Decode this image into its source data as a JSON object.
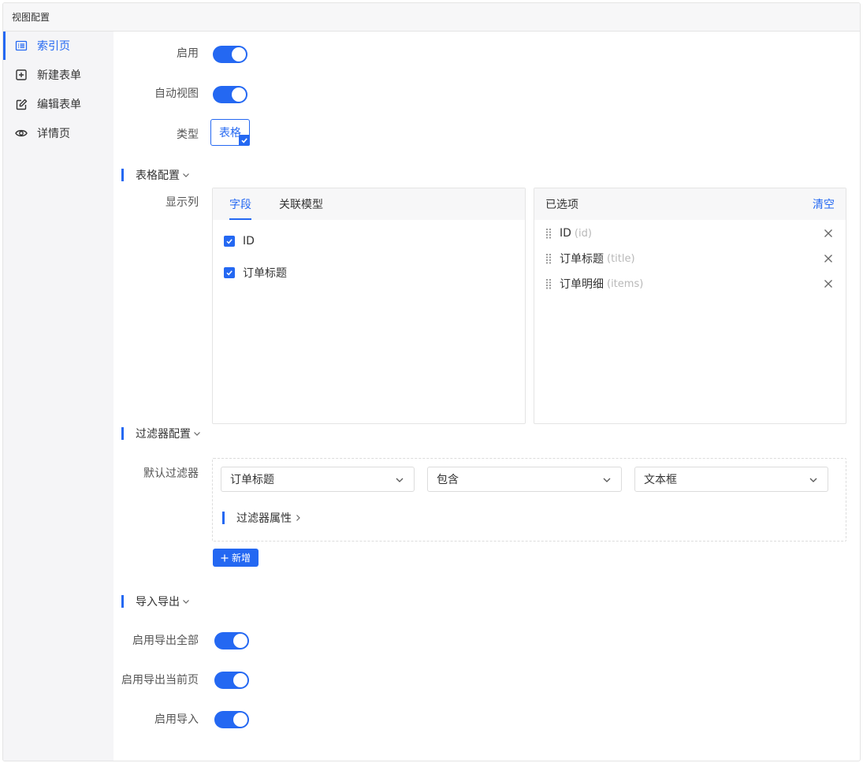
{
  "panel": {
    "title": "视图配置"
  },
  "sidebar": {
    "items": [
      {
        "label": "索引页",
        "icon": "list-icon",
        "active": true
      },
      {
        "label": "新建表单",
        "icon": "plus-square-icon",
        "active": false
      },
      {
        "label": "编辑表单",
        "icon": "edit-icon",
        "active": false
      },
      {
        "label": "详情页",
        "icon": "eye-icon",
        "active": false
      }
    ]
  },
  "basic": {
    "enable_label": "启用",
    "auto_view_label": "自动视图",
    "type_label": "类型",
    "type_option": "表格",
    "enable_on": true,
    "auto_view_on": true
  },
  "table_config": {
    "title": "表格配置",
    "columns_label": "显示列",
    "tabs": [
      "字段",
      "关联模型"
    ],
    "active_tab": "字段",
    "fields": [
      {
        "label": "ID",
        "checked": true
      },
      {
        "label": "订单标题",
        "checked": true
      }
    ],
    "selected_title": "已选项",
    "clear_label": "清空",
    "selected": [
      {
        "name": "ID",
        "key": "(id)"
      },
      {
        "name": "订单标题",
        "key": "(title)"
      },
      {
        "name": "订单明细",
        "key": "(items)"
      }
    ]
  },
  "filter_config": {
    "title": "过滤器配置",
    "default_label": "默认过滤器",
    "field_value": "订单标题",
    "operator_value": "包含",
    "component_value": "文本框",
    "props_title": "过滤器属性",
    "add_label": "新增"
  },
  "import_export": {
    "title": "导入导出",
    "export_all_label": "启用导出全部",
    "export_page_label": "启用导出当前页",
    "import_label": "启用导入",
    "export_all_on": true,
    "export_page_on": true,
    "import_on": true
  },
  "colors": {
    "accent": "#2468f2",
    "sidebar_bg": "#f5f5f7",
    "border": "#e4e4e4"
  }
}
